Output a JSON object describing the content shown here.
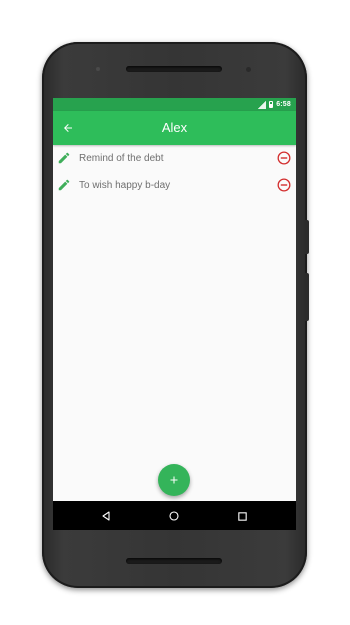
{
  "status_bar": {
    "time": "6:58",
    "icons": [
      "signal-icon",
      "battery-icon"
    ]
  },
  "app_bar": {
    "title": "Alex",
    "back_icon": "arrow-back-icon"
  },
  "reminders": [
    {
      "text": "Remind of the debt",
      "leading_icon": "pencil-icon",
      "trailing_icon": "remove-circle-icon"
    },
    {
      "text": "To wish happy b-day",
      "leading_icon": "pencil-icon",
      "trailing_icon": "remove-circle-icon"
    }
  ],
  "fab": {
    "icon": "plus-icon"
  },
  "nav_bar": {
    "icons": [
      "nav-back-icon",
      "nav-home-icon",
      "nav-recents-icon"
    ]
  },
  "colors": {
    "status_bar": "#27a24e",
    "app_bar": "#2ebd5a",
    "fab": "#34b45a",
    "edit_icon": "#3fae5a",
    "remove_icon": "#d32f2f",
    "item_text": "#6f6f6f",
    "screen_bg": "#fafafa"
  }
}
